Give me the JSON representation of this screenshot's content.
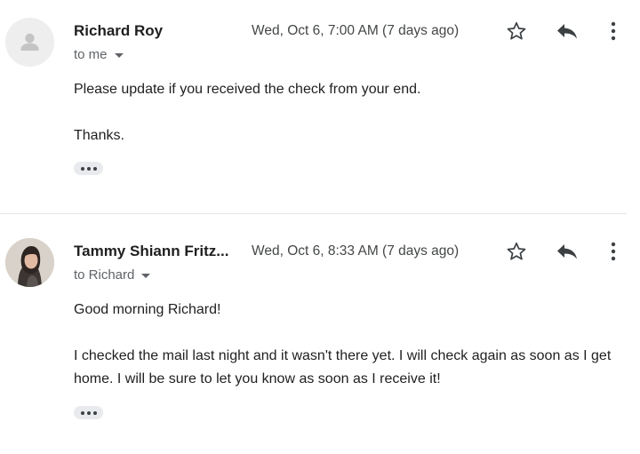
{
  "messages": [
    {
      "sender": "Richard Roy",
      "date": "Wed, Oct 6, 7:00 AM (7 days ago)",
      "recipient": "to me",
      "body_lines": [
        "Please update if you received the check from your end.",
        "Thanks."
      ],
      "avatar_icon": "person-placeholder-icon"
    },
    {
      "sender": "Tammy Shiann Fritz...",
      "date": "Wed, Oct 6, 8:33 AM (7 days ago)",
      "recipient": "to Richard",
      "body_lines": [
        "Good morning Richard!",
        "I checked the mail last night and it wasn't there yet. I will check again as soon as I get home. I will be sure to let you know as soon as I receive it!"
      ],
      "avatar_icon": "profile-photo"
    }
  ],
  "icons": {
    "star": "star-outline-icon",
    "reply": "reply-icon",
    "more": "more-vertical-icon",
    "expand": "show-trimmed-content-icon"
  },
  "colors": {
    "text": "#1f1f1f",
    "secondary_text": "#5f6368",
    "divider": "#e3e3e3"
  }
}
